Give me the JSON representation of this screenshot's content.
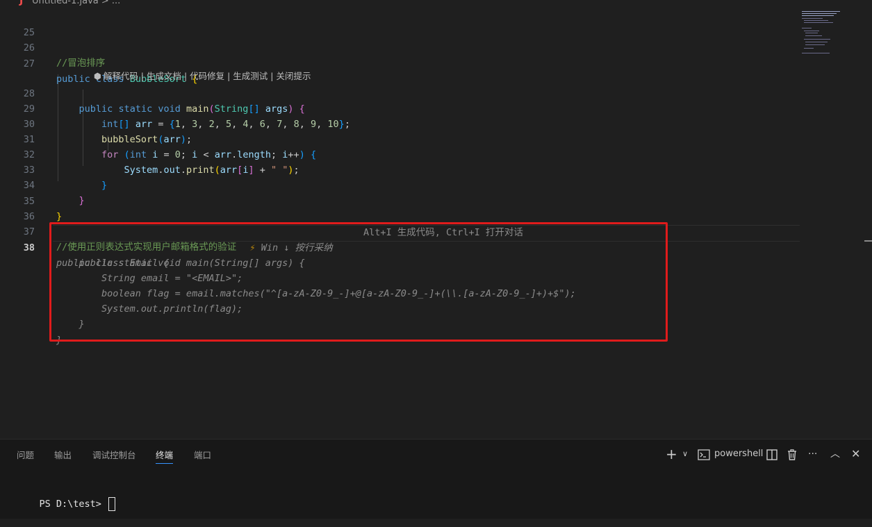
{
  "breadcrumb": {
    "icon": "java-file-icon",
    "text": "Untitled-1.java > ..."
  },
  "editor": {
    "active_line": "38",
    "codelens": "解释代码 | 生成文档 | 代码修复 | 生成测试 | 关闭提示",
    "lines": [
      {
        "n": "25",
        "t": ""
      },
      {
        "n": "26",
        "t": "//冒泡排序"
      },
      {
        "n": "27",
        "t": "public class BubbleSort {"
      },
      {
        "n": "28",
        "t": "    public static void main(String[] args) {"
      },
      {
        "n": "29",
        "t": "        int[] arr = {1, 3, 2, 5, 4, 6, 7, 8, 9, 10};"
      },
      {
        "n": "30",
        "t": "        bubbleSort(arr);"
      },
      {
        "n": "31",
        "t": "        for (int i = 0; i < arr.length; i++) {"
      },
      {
        "n": "32",
        "t": "            System.out.print(arr[i] + \" \");"
      },
      {
        "n": "33",
        "t": "        }"
      },
      {
        "n": "34",
        "t": "    }"
      },
      {
        "n": "35",
        "t": "}"
      },
      {
        "n": "36",
        "t": ""
      },
      {
        "n": "37",
        "t": "//使用正则表达式实现用户邮箱格式的验证"
      },
      {
        "n": "38",
        "t": "public class Email {"
      }
    ],
    "suggestion": [
      "    public static void main(String[] args) {",
      "        String email = \"<EMAIL>\";",
      "        boolean flag = email.matches(\"^[a-zA-Z0-9_-]+@[a-zA-Z0-9_-]+(\\\\.[a-zA-Z0-9_-]+)+$\");",
      "        System.out.println(flag);",
      "    }",
      "}"
    ],
    "inline_hint": {
      "accept": "Win ↓ 按行采纳",
      "shortcuts": "Alt+I 生成代码, Ctrl+I 打开对话"
    }
  },
  "panel": {
    "tabs": [
      "问题",
      "输出",
      "调试控制台",
      "终端",
      "端口"
    ],
    "active_tab": "终端",
    "add_label": "+",
    "shell_label": "powershell",
    "more_label": "···",
    "terminal_prompt": "PS D:\\test>"
  },
  "colors": {
    "highlight_box": "#e01b1b",
    "active_tab_underline": "#3794ff"
  }
}
